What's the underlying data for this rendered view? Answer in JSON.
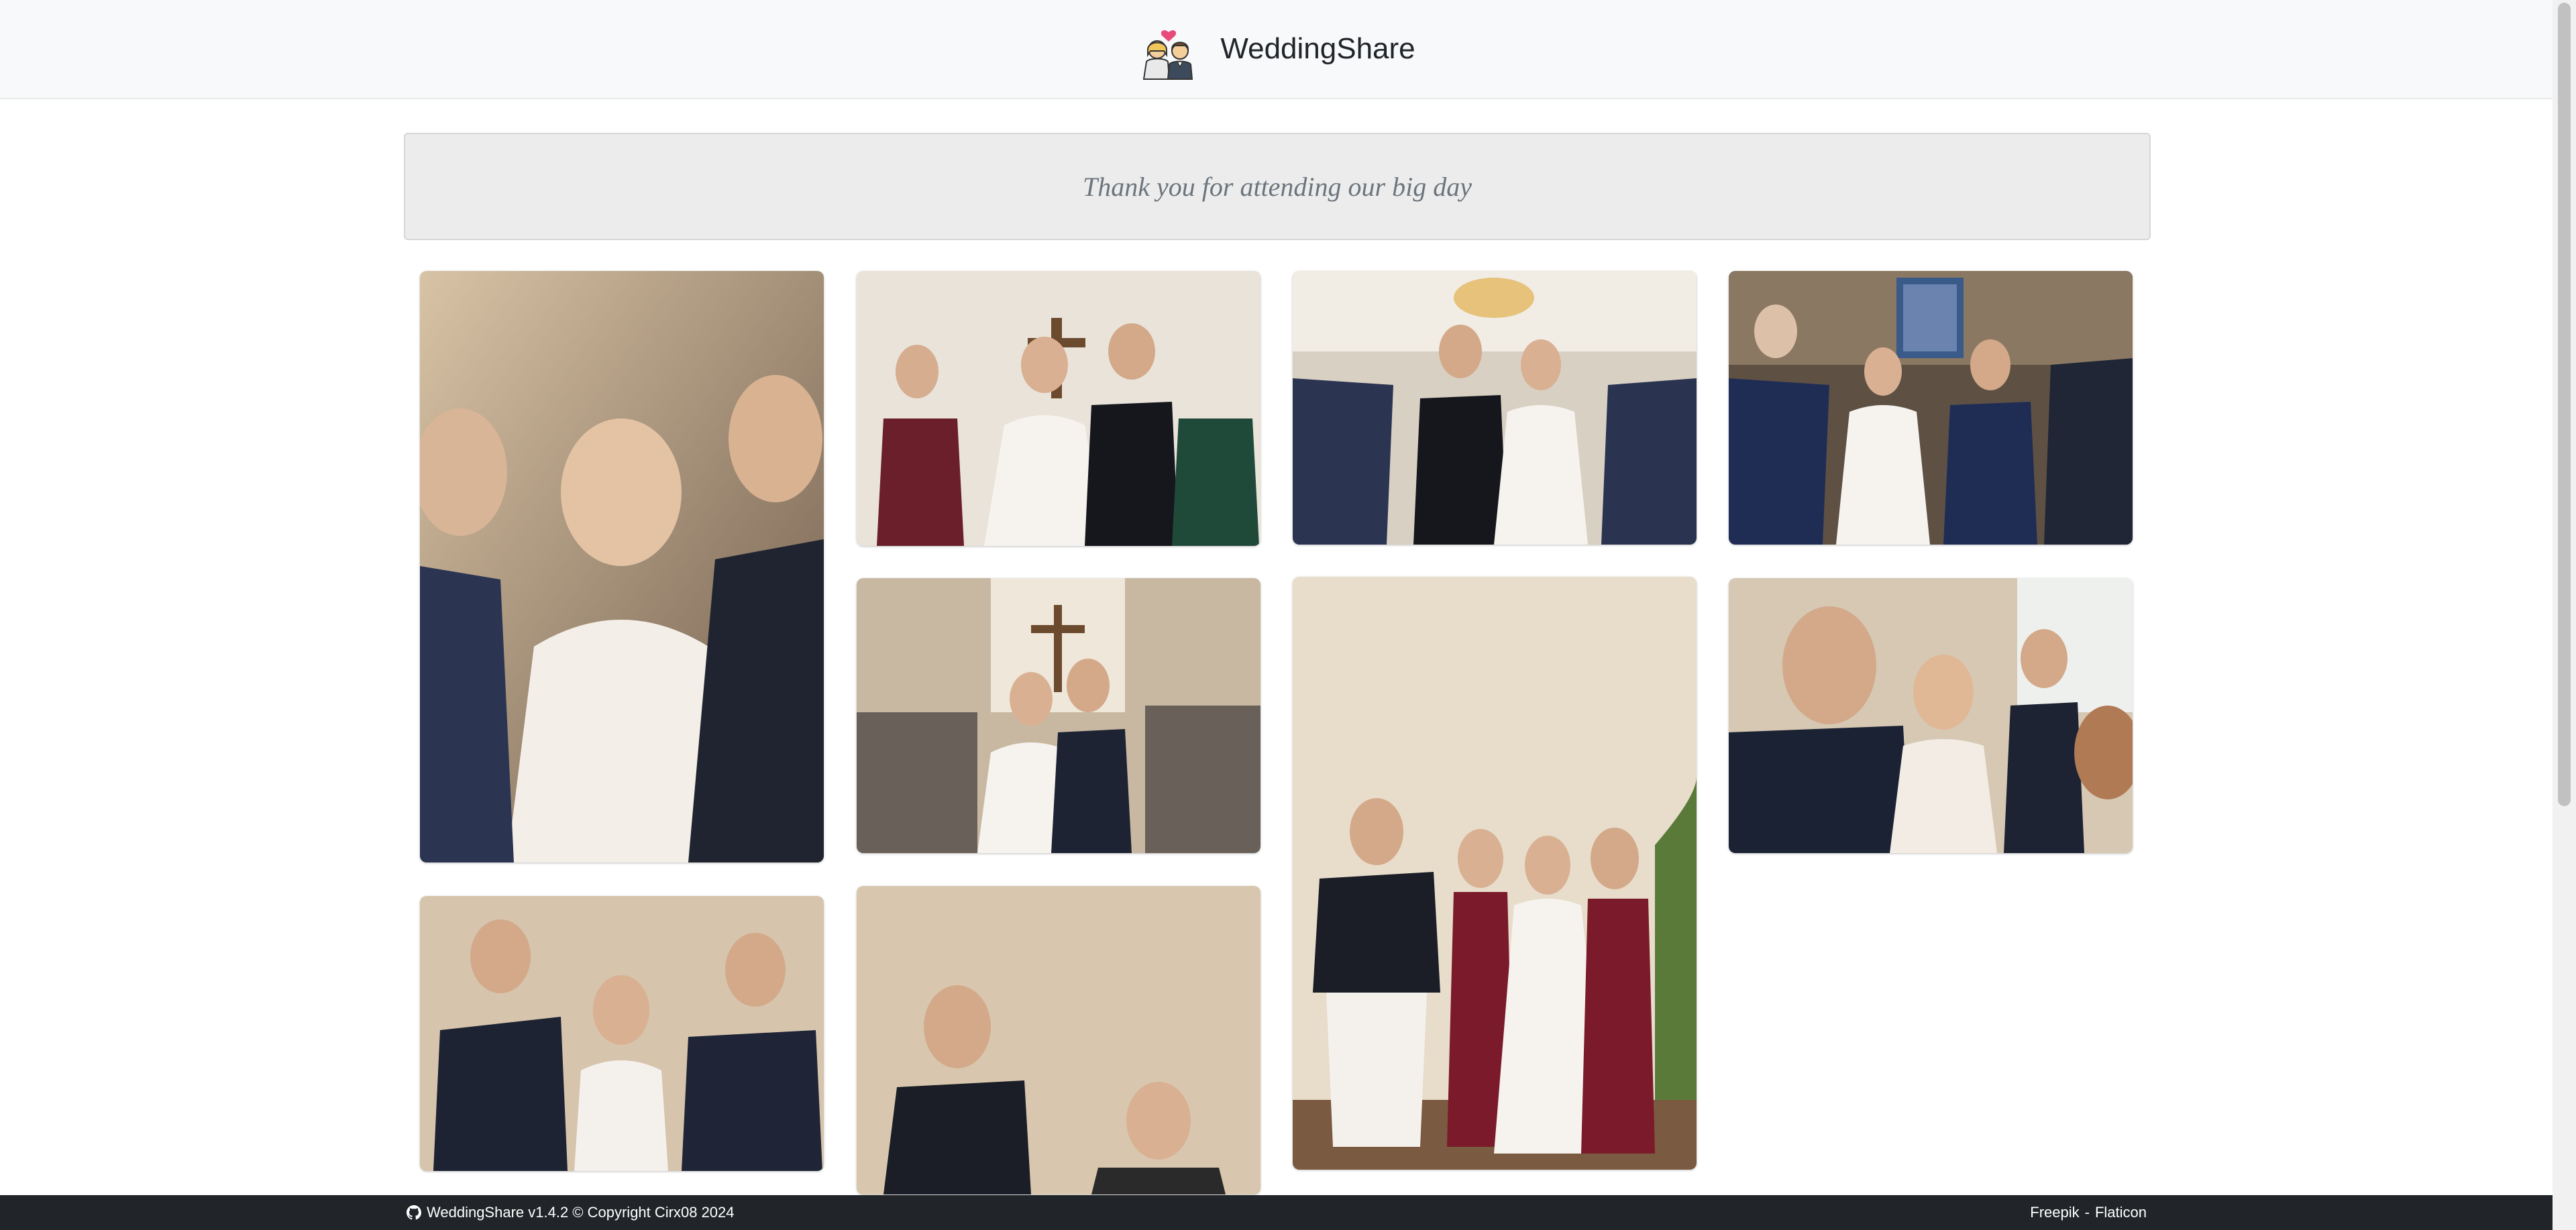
{
  "header": {
    "brand_name": "WeddingShare",
    "logo_icon": "bride-groom-icon"
  },
  "banner": {
    "message": "Thank you for attending our big day"
  },
  "gallery": {
    "photos": [
      {
        "name": "gallery-photo-1",
        "tone": "#a98d6e"
      },
      {
        "name": "gallery-photo-2",
        "tone": "#c9b79e"
      },
      {
        "name": "gallery-photo-3",
        "tone": "#9c8f83"
      },
      {
        "name": "gallery-photo-4",
        "tone": "#6a5d50"
      },
      {
        "name": "gallery-photo-5",
        "tone": "#a08a74"
      },
      {
        "name": "gallery-photo-6",
        "tone": "#cdbb9f"
      },
      {
        "name": "gallery-photo-7",
        "tone": "#8e7e70"
      },
      {
        "name": "gallery-photo-8",
        "tone": "#c8b59a"
      },
      {
        "name": "gallery-photo-9",
        "tone": "#d4c4ab"
      }
    ]
  },
  "footer": {
    "version_text": "WeddingShare v1.4.2 © Copyright Cirx08 2024",
    "credit_freepik": "Freepik",
    "credit_separator": "-",
    "credit_flaticon": "Flaticon",
    "github_icon": "github-icon"
  },
  "colors": {
    "header_bg": "#f8f9fa",
    "banner_bg": "#ececec",
    "footer_bg": "#212529"
  }
}
